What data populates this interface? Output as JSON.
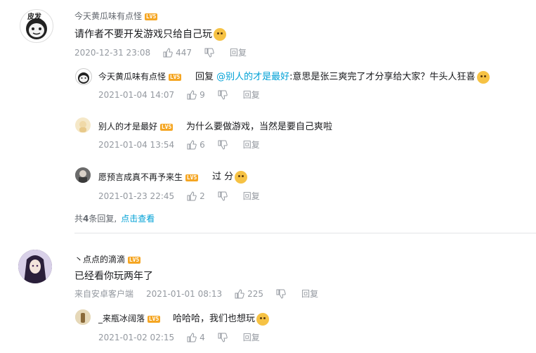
{
  "comments": [
    {
      "user": "今天黄瓜味有点怪",
      "level": "LV5",
      "text": "请作者不要开发游戏只给自己玩",
      "date": "2020-12-31 23:08",
      "likes": "447",
      "reply_label": "回复",
      "replies": [
        {
          "user": "今天黄瓜味有点怪",
          "level": "LV5",
          "reply_word": "回复",
          "mention": "@别人的才是最好",
          "text": ":意思是张三爽完了才分享给大家？牛头人狂喜",
          "date": "2021-01-04 14:07",
          "likes": "9",
          "reply_label": "回复"
        },
        {
          "user": "别人的才是最好",
          "level": "LV5",
          "text": "为什么要做游戏，当然是要自己爽啦",
          "date": "2021-01-04 13:54",
          "likes": "6",
          "reply_label": "回复"
        },
        {
          "user": "愿预言成真不再予来生",
          "level": "LV5",
          "text": "过 分",
          "date": "2021-01-23 22:45",
          "likes": "2",
          "reply_label": "回复"
        }
      ],
      "more_replies_prefix": "共",
      "more_replies_count": "4",
      "more_replies_suffix": "条回复,",
      "more_replies_link": "点击查看"
    },
    {
      "user": "丶点点的滴滴",
      "level": "LV5",
      "text": "已经看你玩两年了",
      "device": "来自安卓客户端",
      "date": "2021-01-01 08:13",
      "likes": "225",
      "reply_label": "回复",
      "replies": [
        {
          "user": "_来瓶冰阔落",
          "level": "LV5",
          "text": "哈哈哈，我们也想玩",
          "date": "2021-01-02 02:15",
          "likes": "4",
          "reply_label": "回复"
        }
      ]
    }
  ],
  "avatar_badge_text": "皮发",
  "colors": {
    "link": "#00a1d6",
    "level_badge": "#f5a623",
    "meta": "#9499a0"
  }
}
